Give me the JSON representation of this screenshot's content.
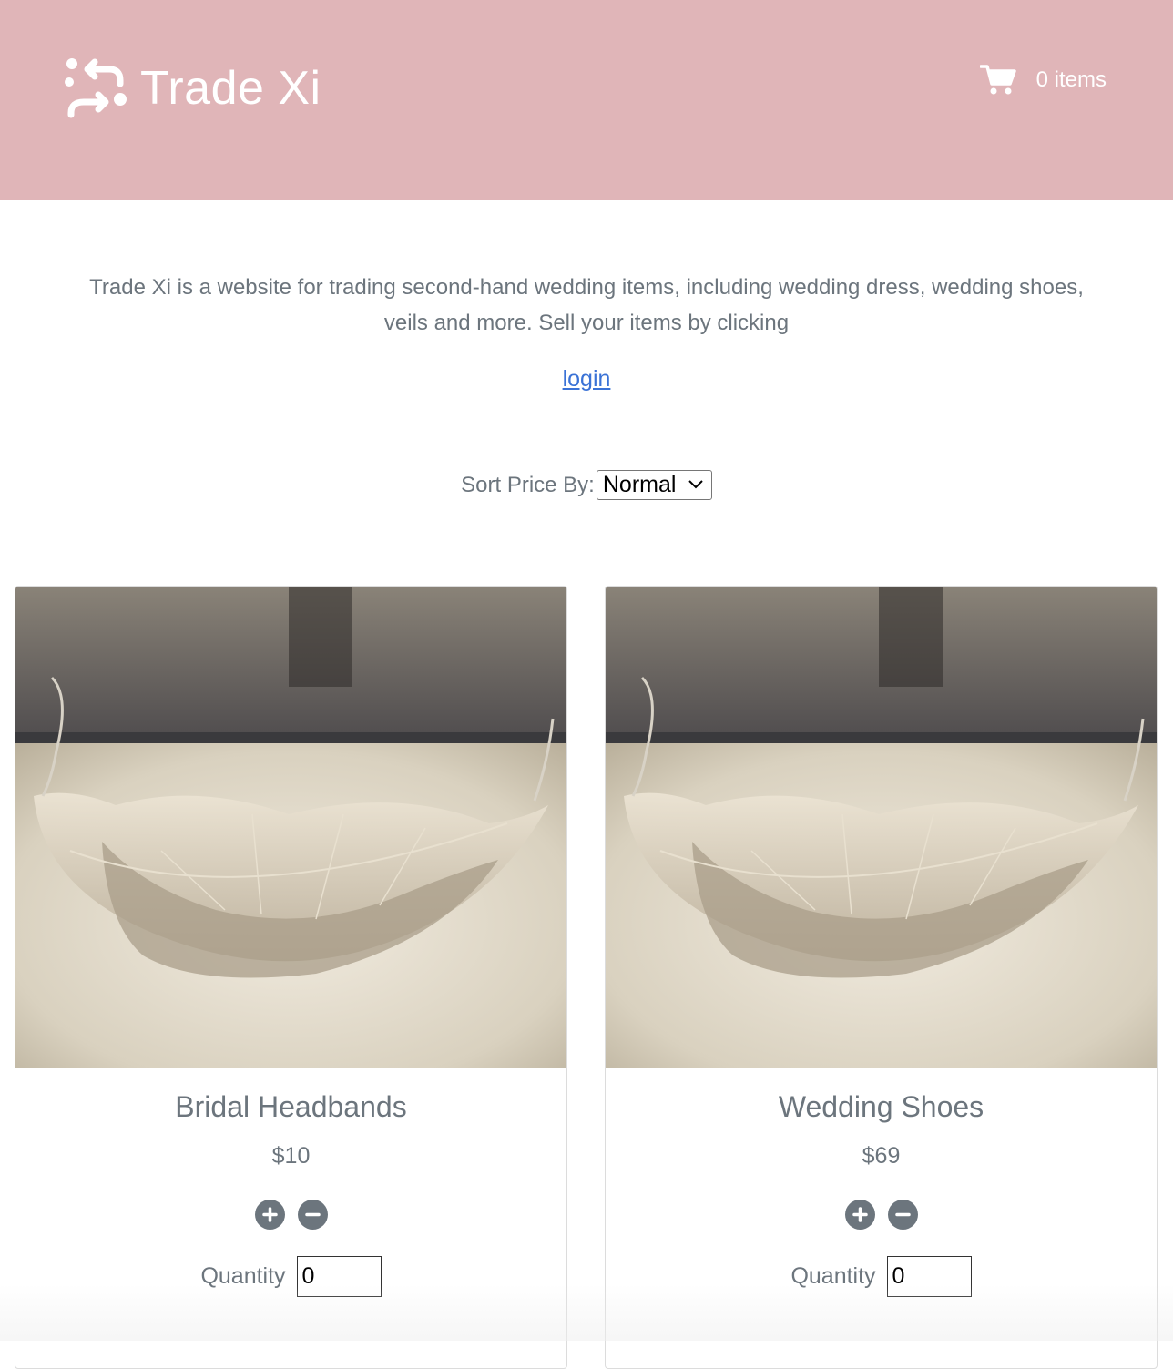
{
  "header": {
    "brand_name": "Trade Xi",
    "brand_icon": "swap-arrows-icon",
    "cart_icon": "shopping-cart-icon",
    "cart_count": "0 items",
    "background_color": "#e0b5b8"
  },
  "intro": {
    "text": "Trade Xi is a website for trading second-hand wedding items, including wedding dress, wedding shoes, veils and more. Sell your items by clicking",
    "login_label": "login"
  },
  "sort": {
    "label": "Sort Price By:",
    "selected": "Normal"
  },
  "products": [
    {
      "name": "Bridal Headbands",
      "price": "$10",
      "quantity_label": "Quantity",
      "quantity_value": "0",
      "image": "leaf-skeleton-photo"
    },
    {
      "name": "Wedding Shoes",
      "price": "$69",
      "quantity_label": "Quantity",
      "quantity_value": "0",
      "image": "leaf-skeleton-photo"
    }
  ],
  "colors": {
    "text_muted": "#6c757d",
    "link": "#3a72d6",
    "button": "#6c757d"
  }
}
